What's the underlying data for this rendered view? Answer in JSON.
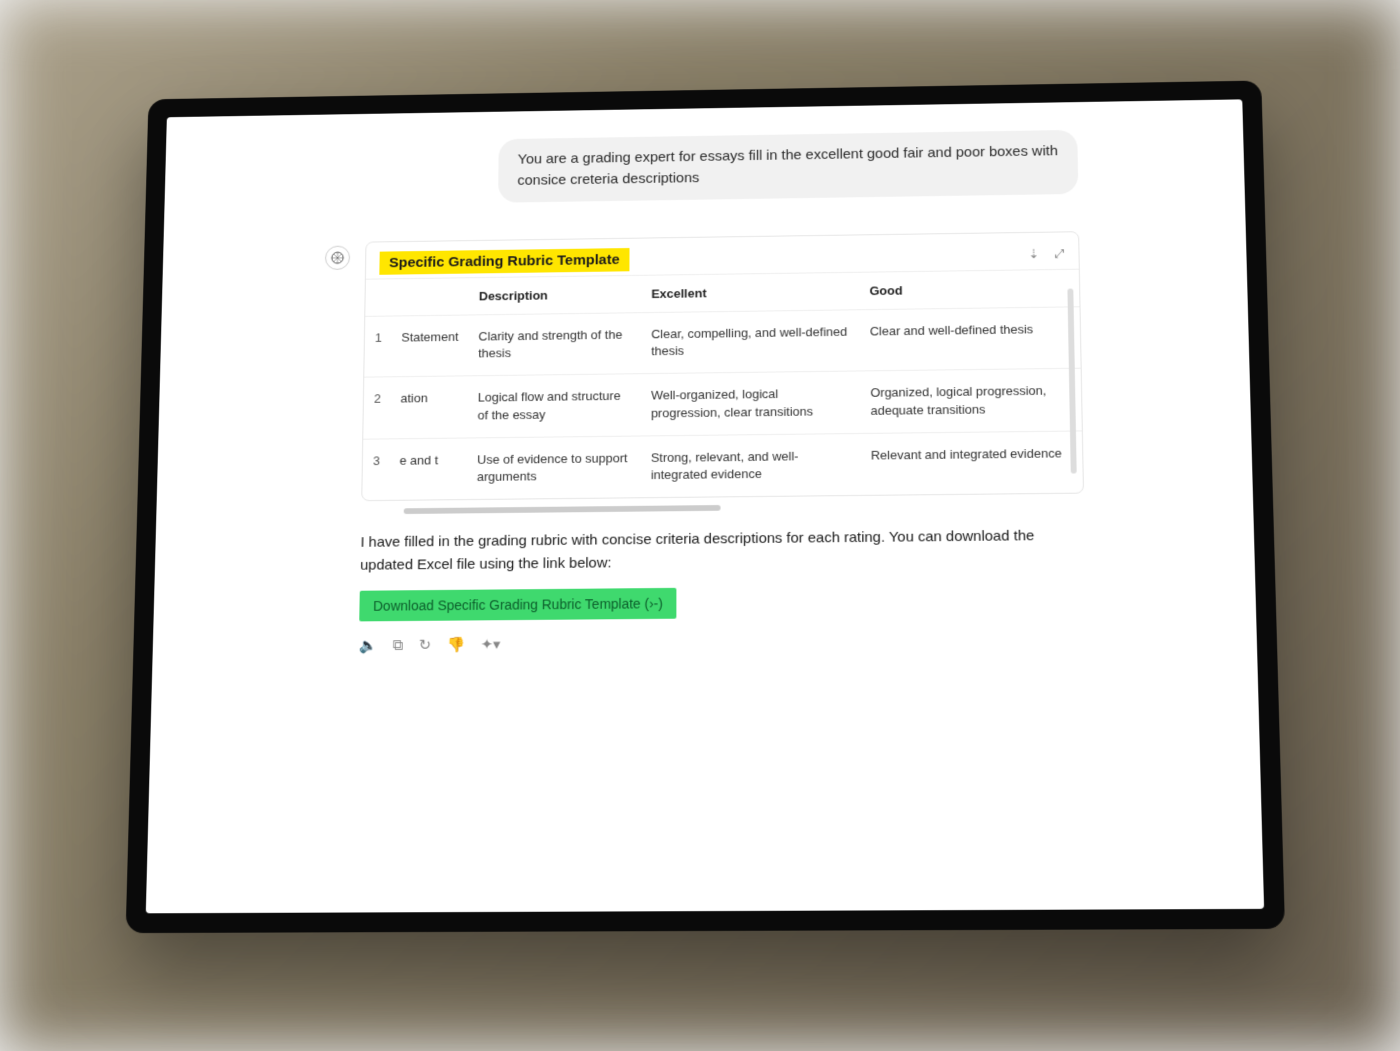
{
  "user_message": "You are a grading expert for essays fill in the excellent good fair and poor boxes with consice creteria descriptions",
  "rubric": {
    "title": "Specific Grading Rubric Template",
    "headers": {
      "description": "Description",
      "excellent": "Excellent",
      "good": "Good"
    },
    "rows": [
      {
        "num": "1",
        "criterion": "Statement",
        "description": "Clarity and strength of the thesis",
        "excellent": "Clear, compelling, and well-defined thesis",
        "good": "Clear and well-defined thesis"
      },
      {
        "num": "2",
        "criterion": "ation",
        "description": "Logical flow and structure of the essay",
        "excellent": "Well-organized, logical progression, clear transitions",
        "good": "Organized, logical progression, adequate transitions"
      },
      {
        "num": "3",
        "criterion": "e and t",
        "description": "Use of evidence to support arguments",
        "excellent": "Strong, relevant, and well-integrated evidence",
        "good": "Relevant and integrated evidence"
      }
    ]
  },
  "assistant_text": "I have filled in the grading rubric with concise criteria descriptions for each rating. You can download the updated Excel file using the link below:",
  "download_label": "Download Specific Grading Rubric Template (›-)",
  "icons": {
    "download": "download-icon",
    "expand": "expand-icon",
    "speaker": "speaker-icon",
    "copy": "copy-icon",
    "regenerate": "regenerate-icon",
    "thumbs_down": "thumbs-down-icon",
    "more": "more-icon"
  }
}
